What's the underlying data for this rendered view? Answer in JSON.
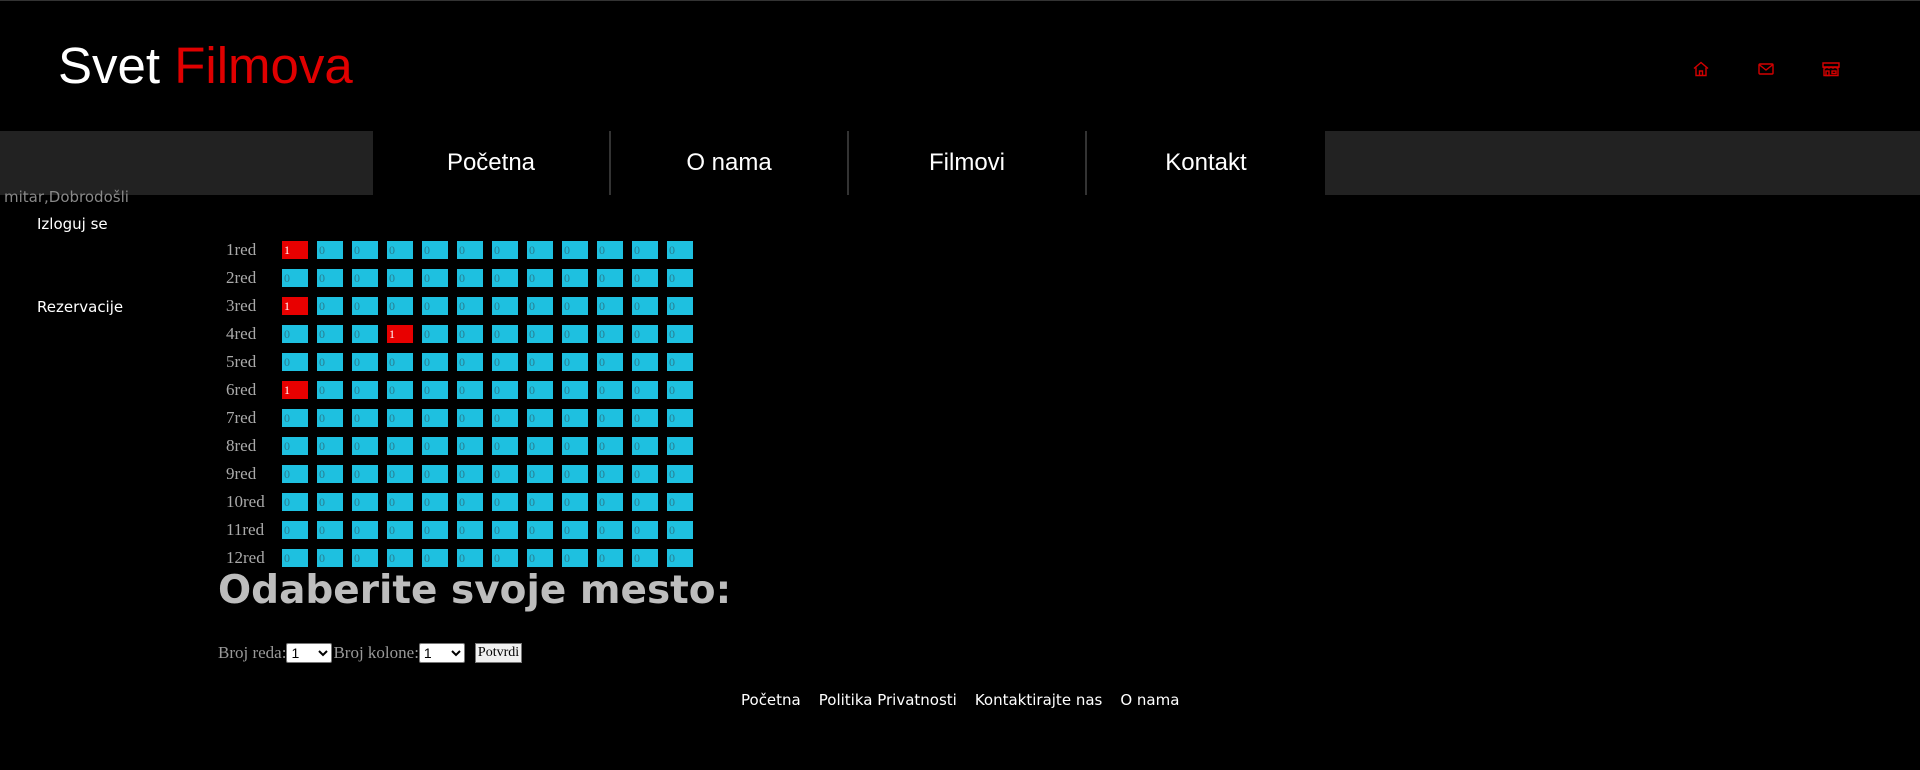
{
  "brand": {
    "part1": "Svet",
    "part2": "Filmova"
  },
  "colors": {
    "accent": "#e00000",
    "seat_free": "#1ec0e0",
    "seat_taken": "#e80000",
    "nav_bg": "#222222"
  },
  "top_icons": [
    {
      "name": "home-icon"
    },
    {
      "name": "mail-icon"
    },
    {
      "name": "store-icon"
    }
  ],
  "nav": {
    "items": [
      {
        "label": "Početna"
      },
      {
        "label": "O nama"
      },
      {
        "label": "Filmovi"
      },
      {
        "label": "Kontakt"
      }
    ]
  },
  "sidebar": {
    "welcome": "mitar,Dobrodošli",
    "logout": "Izloguj se",
    "reservations": "Rezervacije"
  },
  "seats": {
    "rows": [
      {
        "label": "1red",
        "values": [
          1,
          0,
          0,
          0,
          0,
          0,
          0,
          0,
          0,
          0,
          0,
          0
        ]
      },
      {
        "label": "2red",
        "values": [
          0,
          0,
          0,
          0,
          0,
          0,
          0,
          0,
          0,
          0,
          0,
          0
        ]
      },
      {
        "label": "3red",
        "values": [
          1,
          0,
          0,
          0,
          0,
          0,
          0,
          0,
          0,
          0,
          0,
          0
        ]
      },
      {
        "label": "4red",
        "values": [
          0,
          0,
          0,
          1,
          0,
          0,
          0,
          0,
          0,
          0,
          0,
          0
        ]
      },
      {
        "label": "5red",
        "values": [
          0,
          0,
          0,
          0,
          0,
          0,
          0,
          0,
          0,
          0,
          0,
          0
        ]
      },
      {
        "label": "6red",
        "values": [
          1,
          0,
          0,
          0,
          0,
          0,
          0,
          0,
          0,
          0,
          0,
          0
        ]
      },
      {
        "label": "7red",
        "values": [
          0,
          0,
          0,
          0,
          0,
          0,
          0,
          0,
          0,
          0,
          0,
          0
        ]
      },
      {
        "label": "8red",
        "values": [
          0,
          0,
          0,
          0,
          0,
          0,
          0,
          0,
          0,
          0,
          0,
          0
        ]
      },
      {
        "label": "9red",
        "values": [
          0,
          0,
          0,
          0,
          0,
          0,
          0,
          0,
          0,
          0,
          0,
          0
        ]
      },
      {
        "label": "10red",
        "values": [
          0,
          0,
          0,
          0,
          0,
          0,
          0,
          0,
          0,
          0,
          0,
          0
        ]
      },
      {
        "label": "11red",
        "values": [
          0,
          0,
          0,
          0,
          0,
          0,
          0,
          0,
          0,
          0,
          0,
          0
        ]
      },
      {
        "label": "12red",
        "values": [
          0,
          0,
          0,
          0,
          0,
          0,
          0,
          0,
          0,
          0,
          0,
          0
        ]
      }
    ]
  },
  "selection": {
    "heading": "Odaberite svoje mesto:",
    "row_label": "Broj reda:",
    "row_value": "1",
    "col_label": "Broj kolone:",
    "col_value": "1",
    "confirm": "Potvrdi"
  },
  "footer": {
    "links": [
      {
        "label": "Početna"
      },
      {
        "label": "Politika Privatnosti"
      },
      {
        "label": "Kontaktirajte nas"
      },
      {
        "label": "O nama"
      }
    ]
  }
}
